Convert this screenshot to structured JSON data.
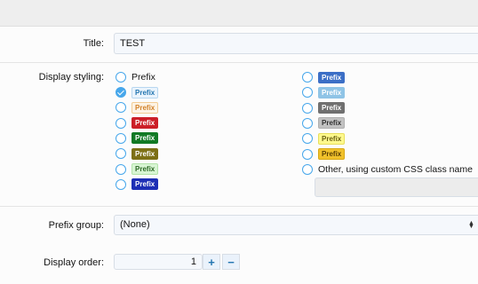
{
  "form": {
    "title_label": "Title:",
    "title_value": "TEST",
    "styling_label": "Display styling:",
    "prefix_group_label": "Prefix group:",
    "prefix_group_value": "(None)",
    "display_order_label": "Display order:",
    "display_order_value": "1"
  },
  "styling": {
    "plain_text": "Prefix",
    "custom_text": "Other, using custom CSS class name",
    "selected_index": 1,
    "left": [
      {
        "text": "Prefix",
        "bg": "#eaf4fd",
        "fg": "#2577b1",
        "border": "#b8d7f0"
      },
      {
        "text": "Prefix",
        "bg": "#fdf3e4",
        "fg": "#d2822a",
        "border": "#f2cc95"
      },
      {
        "text": "Prefix",
        "bg": "#cc1f28",
        "fg": "#ffffff",
        "border": "#cc1f28"
      },
      {
        "text": "Prefix",
        "bg": "#127a25",
        "fg": "#ffffff",
        "border": "#127a25"
      },
      {
        "text": "Prefix",
        "bg": "#7d7016",
        "fg": "#ffffff",
        "border": "#7d7016"
      },
      {
        "text": "Prefix",
        "bg": "#d8f5d3",
        "fg": "#2f6a27",
        "border": "#b3e3a9"
      },
      {
        "text": "Prefix",
        "bg": "#1d2fb5",
        "fg": "#ffffff",
        "border": "#1d2fb5"
      }
    ],
    "right": [
      {
        "text": "Prefix",
        "bg": "#3c6fc6",
        "fg": "#ffffff",
        "border": "#3c6fc6"
      },
      {
        "text": "Prefix",
        "bg": "#8fc4e6",
        "fg": "#ffffff",
        "border": "#8fc4e6"
      },
      {
        "text": "Prefix",
        "bg": "#707070",
        "fg": "#ffffff",
        "border": "#707070"
      },
      {
        "text": "Prefix",
        "bg": "#c2c2c2",
        "fg": "#333333",
        "border": "#b0b0b0"
      },
      {
        "text": "Prefix",
        "bg": "#fff98d",
        "fg": "#6b6212",
        "border": "#e8df5c"
      },
      {
        "text": "Prefix",
        "bg": "#f1c12b",
        "fg": "#5b4005",
        "border": "#d9a915"
      }
    ]
  },
  "stepper": {
    "plus": "+",
    "minus": "−"
  },
  "icons": {
    "select_arrows": "▲▼"
  }
}
